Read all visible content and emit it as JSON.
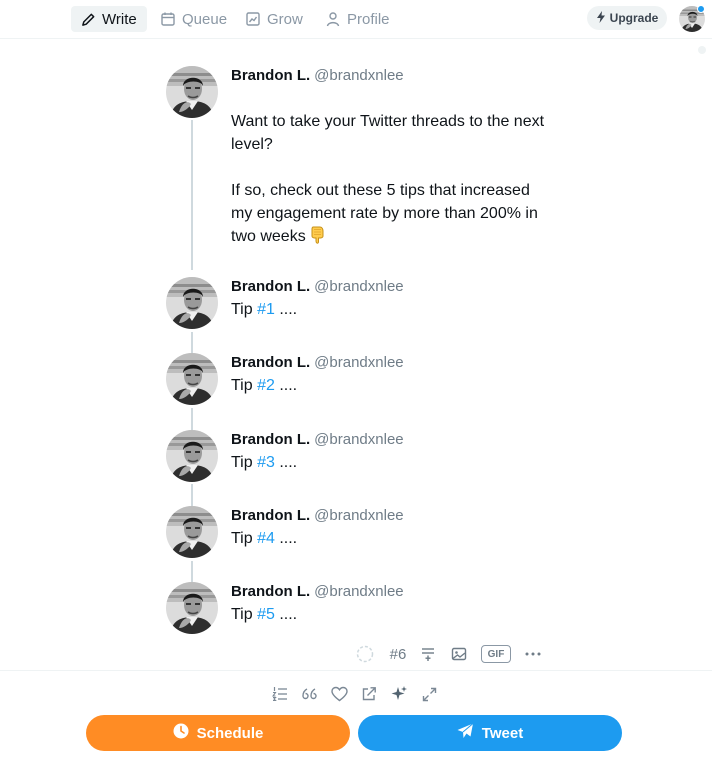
{
  "nav": {
    "tabs": [
      {
        "label": "Write",
        "icon": "pencil-icon",
        "active": true
      },
      {
        "label": "Queue",
        "icon": "calendar-icon",
        "active": false
      },
      {
        "label": "Grow",
        "icon": "chart-icon",
        "active": false
      },
      {
        "label": "Profile",
        "icon": "person-icon",
        "active": false
      }
    ],
    "upgrade_label": "Upgrade"
  },
  "author": {
    "name": "Brandon L.",
    "handle": "@brandxnlee"
  },
  "thread": {
    "first_tweet": {
      "line1": "Want to take your Twitter threads to the next level?",
      "line2": "If so, check out these 5 tips that increased my engagement rate by more than 200% in two weeks",
      "emoji": "pointing-down-hand"
    },
    "tips": [
      {
        "prefix": "Tip",
        "hashtag": "#1",
        "suffix": "...."
      },
      {
        "prefix": "Tip",
        "hashtag": "#2",
        "suffix": "...."
      },
      {
        "prefix": "Tip",
        "hashtag": "#3",
        "suffix": "...."
      },
      {
        "prefix": "Tip",
        "hashtag": "#4",
        "suffix": "...."
      },
      {
        "prefix": "Tip",
        "hashtag": "#5",
        "suffix": "...."
      }
    ]
  },
  "composer": {
    "tweet_count": "#6",
    "gif_label": "GIF"
  },
  "actions": {
    "schedule_label": "Schedule",
    "tweet_label": "Tweet"
  },
  "colors": {
    "accent": "#1d9bf0",
    "schedule": "#ff8c24",
    "muted": "#6f7c87"
  }
}
